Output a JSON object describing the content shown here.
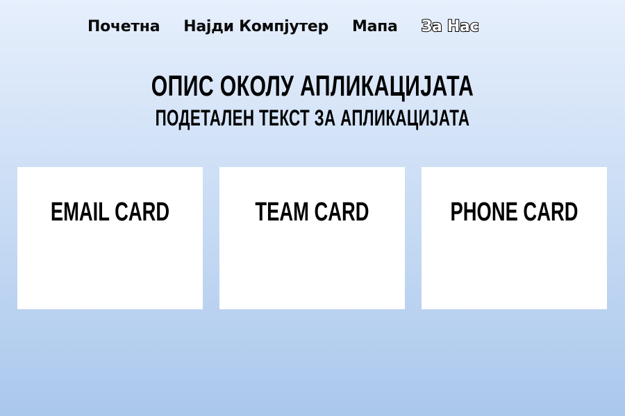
{
  "nav": {
    "items": [
      {
        "label": "Почетна"
      },
      {
        "label": "Најди Компјутер"
      },
      {
        "label": "Мапа"
      },
      {
        "label": "За Нас",
        "active": true
      }
    ]
  },
  "hero": {
    "title": "ОПИС ОКОЛУ АПЛИКАЦИЈАТА",
    "subtitle": "ПОДЕТАЛЕН ТЕКСТ ЗА АПЛИКАЦИЈАТА"
  },
  "cards": [
    {
      "title": "EMAIL CARD"
    },
    {
      "title": "TEAM CARD"
    },
    {
      "title": "PHONE CARD"
    }
  ]
}
